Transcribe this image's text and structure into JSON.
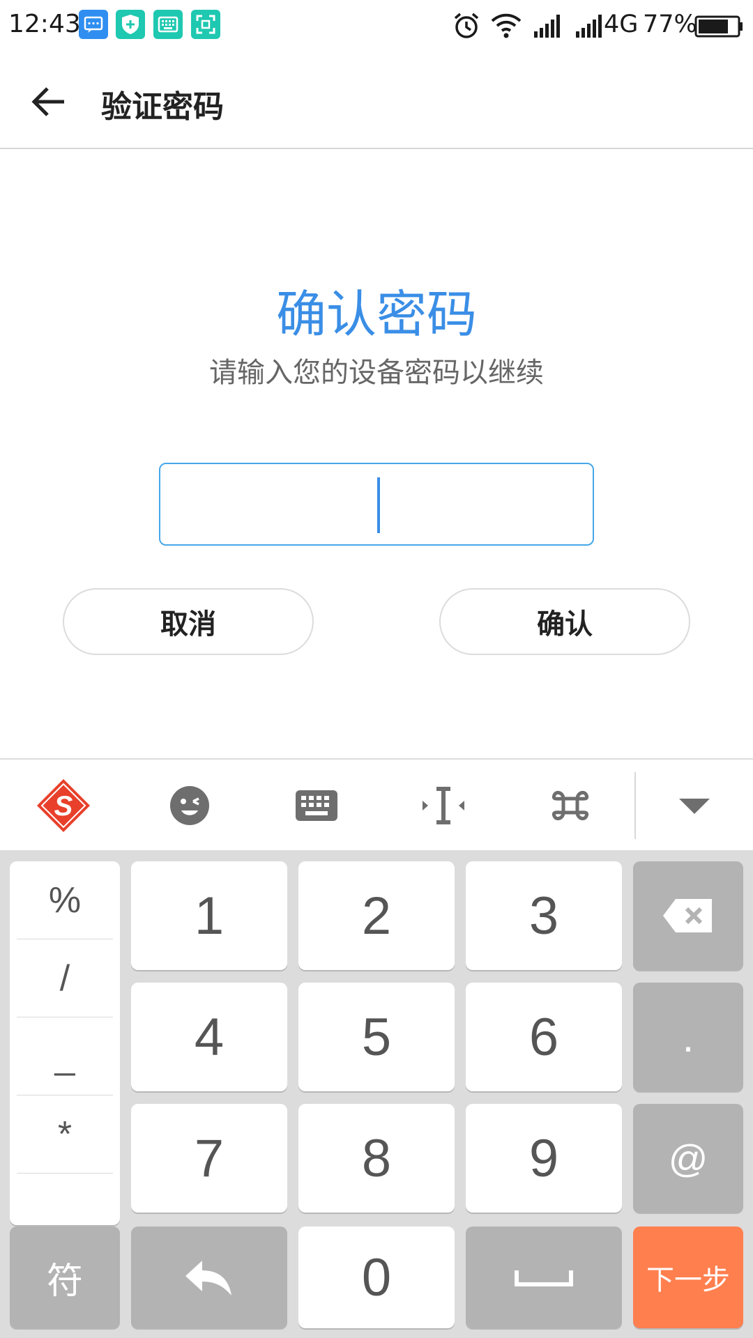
{
  "status_bar": {
    "time": "12:43",
    "network": "4G",
    "battery": "77%",
    "icons": [
      "message-icon",
      "shield-icon",
      "keyboard-icon",
      "scan-icon",
      "alarm-icon",
      "wifi-icon",
      "signal-icon",
      "battery-icon"
    ]
  },
  "app_bar": {
    "title": "验证密码",
    "back_icon": "arrow-left-icon"
  },
  "content": {
    "heading": "确认密码",
    "subheading": "请输入您的设备密码以继续",
    "password_value": "",
    "cancel_label": "取消",
    "confirm_label": "确认"
  },
  "keyboard_toolbar": {
    "items": [
      "sogou-logo-icon",
      "emoji-icon",
      "keyboard-icon",
      "cursor-move-icon",
      "command-icon",
      "collapse-icon"
    ]
  },
  "keypad": {
    "symbols": [
      "%",
      "/",
      "_",
      "*"
    ],
    "keys": [
      "1",
      "2",
      "3",
      "4",
      "5",
      "6",
      "7",
      "8",
      "9",
      "0",
      ".",
      "@"
    ],
    "symbol_key": "符",
    "next_label": "下一步",
    "special_icons": [
      "backspace-icon",
      "return-icon",
      "space-icon"
    ]
  },
  "colors": {
    "accent": "#3a8ee6",
    "input_border": "#47a7e8",
    "next_key": "#ff7f4f",
    "key_gray": "#b3b3b3",
    "keypad_bg": "#dcdcdc"
  }
}
